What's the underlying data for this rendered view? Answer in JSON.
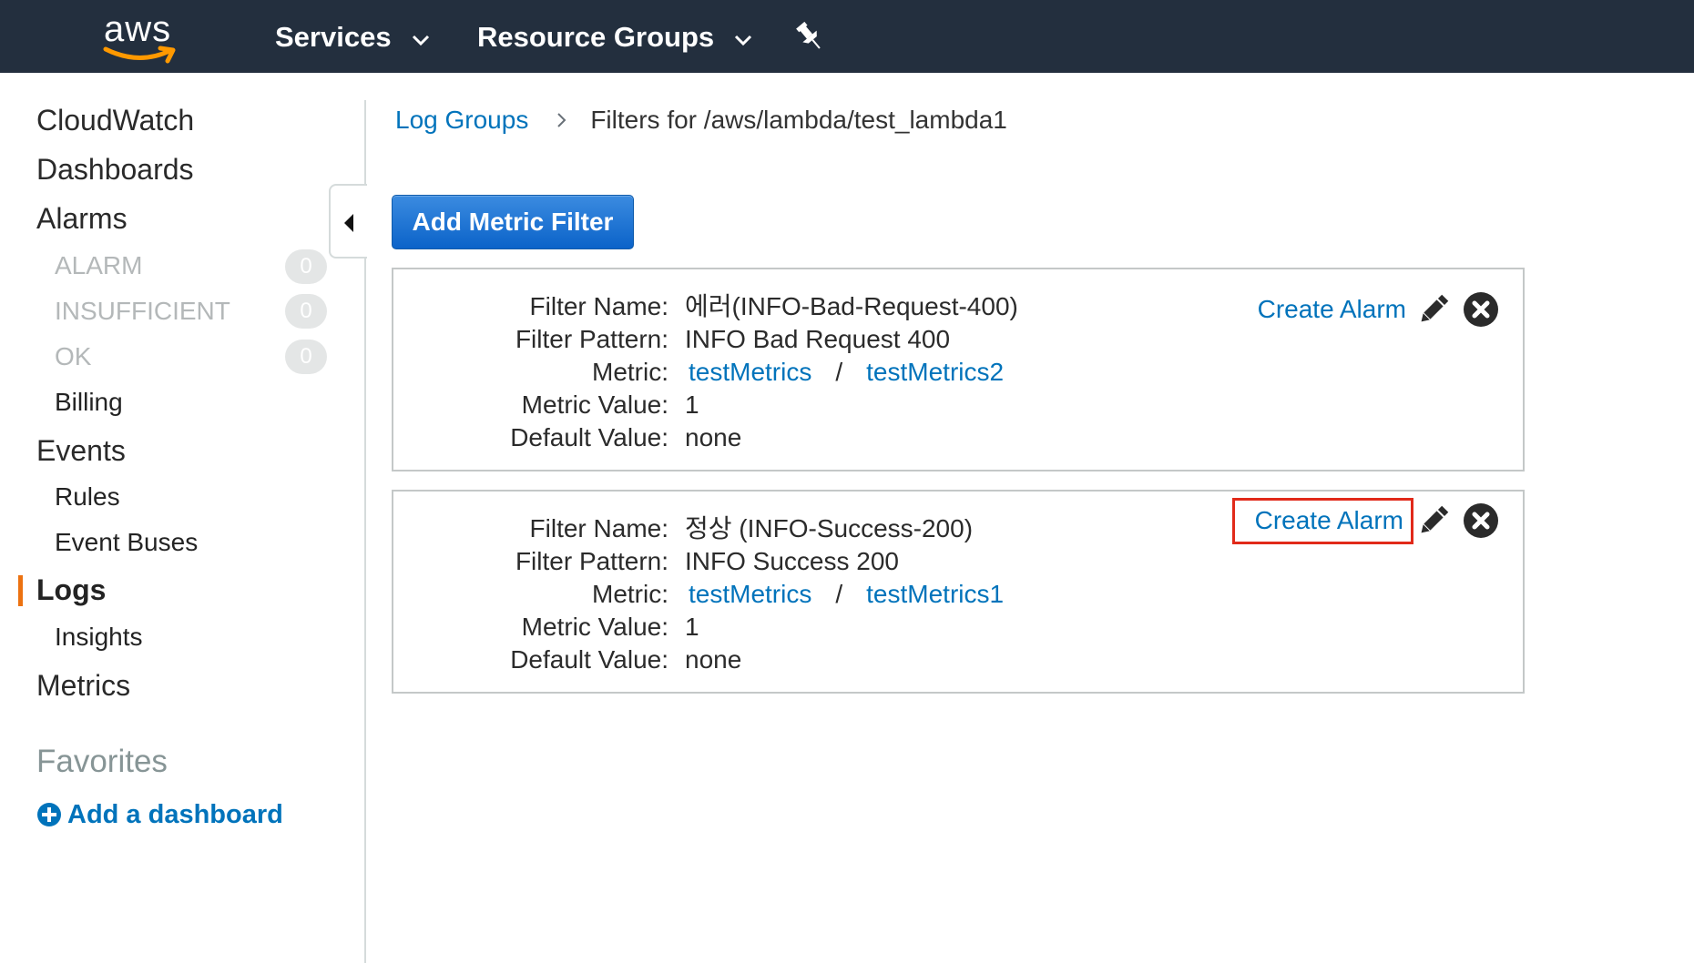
{
  "topbar": {
    "logo_text": "aws",
    "services_label": "Services",
    "resource_groups_label": "Resource Groups",
    "background_color": "#232f3e",
    "logo_smile_color": "#ff9900"
  },
  "sidebar": {
    "cloudwatch": "CloudWatch",
    "dashboards": "Dashboards",
    "alarms": "Alarms",
    "alarm_states": [
      {
        "label": "ALARM",
        "count": "0"
      },
      {
        "label": "INSUFFICIENT",
        "count": "0"
      },
      {
        "label": "OK",
        "count": "0"
      }
    ],
    "billing": "Billing",
    "events": "Events",
    "rules": "Rules",
    "event_buses": "Event Buses",
    "logs": "Logs",
    "insights": "Insights",
    "metrics": "Metrics",
    "favorites": "Favorites",
    "add_dashboard": "Add a dashboard",
    "active_accent_color": "#ec7211"
  },
  "breadcrumb": {
    "log_groups": "Log Groups",
    "current": "Filters for /aws/lambda/test_lambda1"
  },
  "toolbar": {
    "add_metric_filter": "Add Metric Filter"
  },
  "labels": {
    "filter_name": "Filter Name:",
    "filter_pattern": "Filter Pattern:",
    "metric": "Metric:",
    "metric_value": "Metric Value:",
    "default_value": "Default Value:",
    "create_alarm": "Create Alarm",
    "slash": "/"
  },
  "filters": [
    {
      "filter_name": "에러(INFO-Bad-Request-400)",
      "filter_pattern": "INFO Bad Request 400",
      "metric_namespace": "testMetrics",
      "metric_name": "testMetrics2",
      "metric_value": "1",
      "default_value": "none",
      "create_alarm_highlighted": false
    },
    {
      "filter_name": "정상 (INFO-Success-200)",
      "filter_pattern": "INFO Success 200",
      "metric_namespace": "testMetrics",
      "metric_name": "testMetrics1",
      "metric_value": "1",
      "default_value": "none",
      "create_alarm_highlighted": true
    }
  ],
  "colors": {
    "link": "#0073bb",
    "primary_button": "#0b63c9",
    "highlight_box": "#e12a1a"
  },
  "icons": {
    "services_chevron": "chevron-down-icon",
    "resource_groups_chevron": "chevron-down-icon",
    "pin": "pin-icon",
    "collapse": "caret-left-icon",
    "add_dashboard": "plus-circle-icon",
    "edit": "pencil-icon",
    "delete": "close-circle-icon",
    "breadcrumb_separator": "chevron-right-icon"
  }
}
